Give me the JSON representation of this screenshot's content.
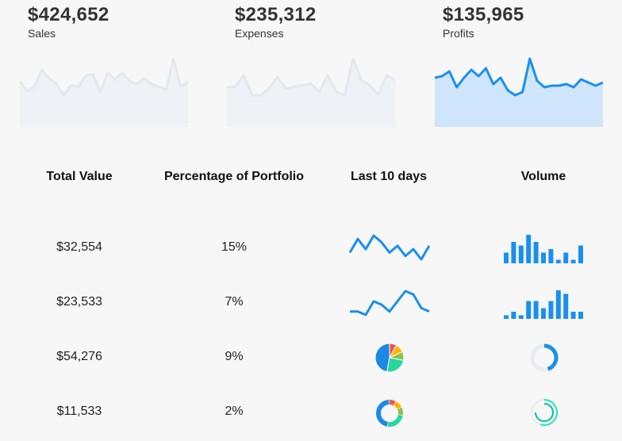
{
  "kpis": [
    {
      "value": "$424,652",
      "label": "Sales",
      "sparkline": [
        12,
        5,
        8,
        20,
        14,
        10,
        2,
        9,
        8,
        16,
        17,
        4,
        18,
        13,
        18,
        12,
        10,
        14,
        10,
        8,
        6,
        28,
        8,
        11
      ],
      "fill": "#eef1f5",
      "stroke": "#e3e8ee",
      "highlighted": false
    },
    {
      "value": "$235,312",
      "label": "Expenses",
      "sparkline": [
        11,
        11,
        18,
        6,
        6,
        10,
        17,
        10,
        11,
        12,
        13,
        8,
        18,
        8,
        6,
        28,
        15,
        12,
        6,
        18,
        15
      ],
      "fill": "#eef1f5",
      "stroke": "#e3e8ee",
      "highlighted": false
    },
    {
      "value": "$135,965",
      "label": "Profits",
      "sparkline": [
        14,
        15,
        18,
        8,
        14,
        19,
        15,
        20,
        10,
        14,
        6,
        3,
        5,
        26,
        12,
        8,
        9,
        9,
        10,
        8,
        13,
        11,
        9,
        11
      ],
      "fill": "#cfe5fb",
      "stroke": "#1a90ee",
      "highlighted": true
    }
  ],
  "table": {
    "headers": [
      "Total Value",
      "Percentage of Portfolio",
      "Last 10 days",
      "Volume"
    ],
    "rows": [
      {
        "total": "$32,554",
        "pct": "15%",
        "trend_type": "line",
        "trend": [
          3,
          7,
          4,
          8,
          6,
          3,
          5,
          2,
          4,
          1,
          5
        ],
        "volume_type": "bar",
        "volume": [
          3,
          6,
          5,
          8,
          6,
          3,
          4,
          1,
          3,
          1,
          5
        ]
      },
      {
        "total": "$23,533",
        "pct": "7%",
        "trend_type": "line",
        "trend": [
          2,
          2,
          1,
          5,
          4,
          2,
          5,
          8,
          7,
          3,
          2
        ],
        "volume_type": "bar",
        "volume": [
          1,
          2,
          1,
          5,
          5,
          3,
          5,
          8,
          7,
          2,
          2
        ]
      },
      {
        "total": "$54,276",
        "pct": "9%",
        "trend_type": "pie",
        "trend": [
          8,
          10,
          10,
          25,
          47
        ],
        "trend_colors": [
          "#ef5350",
          "#ffb300",
          "#8bc34a",
          "#26d7a0",
          "#1e88e5"
        ],
        "volume_type": "gauge",
        "volume": [
          0.45
        ]
      },
      {
        "total": "$11,533",
        "pct": "2%",
        "trend_type": "donut",
        "trend": [
          8,
          10,
          10,
          25,
          47
        ],
        "trend_colors": [
          "#ef5350",
          "#ffb300",
          "#8bc34a",
          "#26d7a0",
          "#1e88e5"
        ],
        "volume_type": "rings",
        "volume": [
          0.55,
          0.75
        ]
      }
    ]
  },
  "colors": {
    "accent": "#1a90ee",
    "track": "#e9ecf0"
  }
}
